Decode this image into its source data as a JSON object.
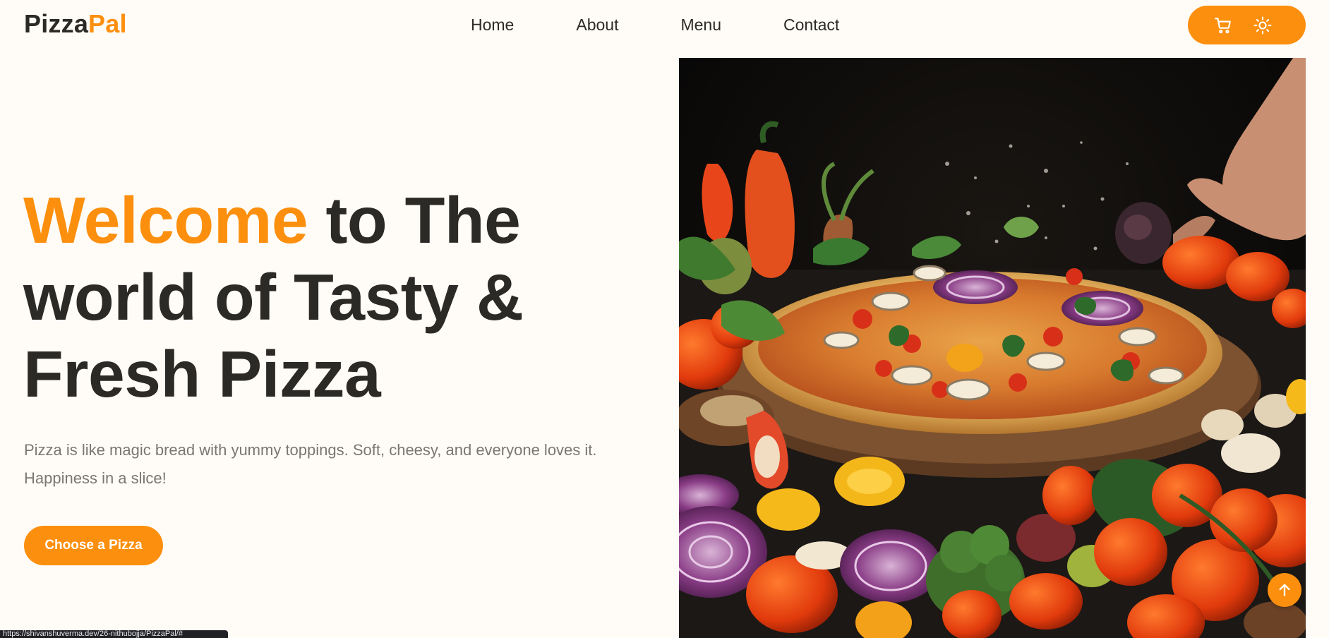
{
  "colors": {
    "accent": "#fc8f0e",
    "text_dark": "#2c2a27",
    "text_muted": "#7a7672",
    "background": "#fffcf7"
  },
  "header": {
    "logo_part1": "Pizza",
    "logo_part2": "Pal",
    "nav": [
      {
        "label": "Home"
      },
      {
        "label": "About"
      },
      {
        "label": "Menu"
      },
      {
        "label": "Contact"
      }
    ],
    "actions": {
      "cart_icon": "cart-icon",
      "theme_icon": "sun-icon"
    }
  },
  "hero": {
    "title_accent": "Welcome",
    "title_rest": " to The world of Tasty & Fresh Pizza",
    "description": "Pizza is like magic bread with yummy toppings. Soft, cheesy, and everyone loves it. Happiness in a slice!",
    "cta_label": "Choose a Pizza",
    "image_icon": "pizza-photo"
  },
  "scroll_top_icon": "arrow-up-icon",
  "status_bar": {
    "url_text": "https://shivanshuverma.dev/26-nithubojja/PizzaPal/#"
  }
}
